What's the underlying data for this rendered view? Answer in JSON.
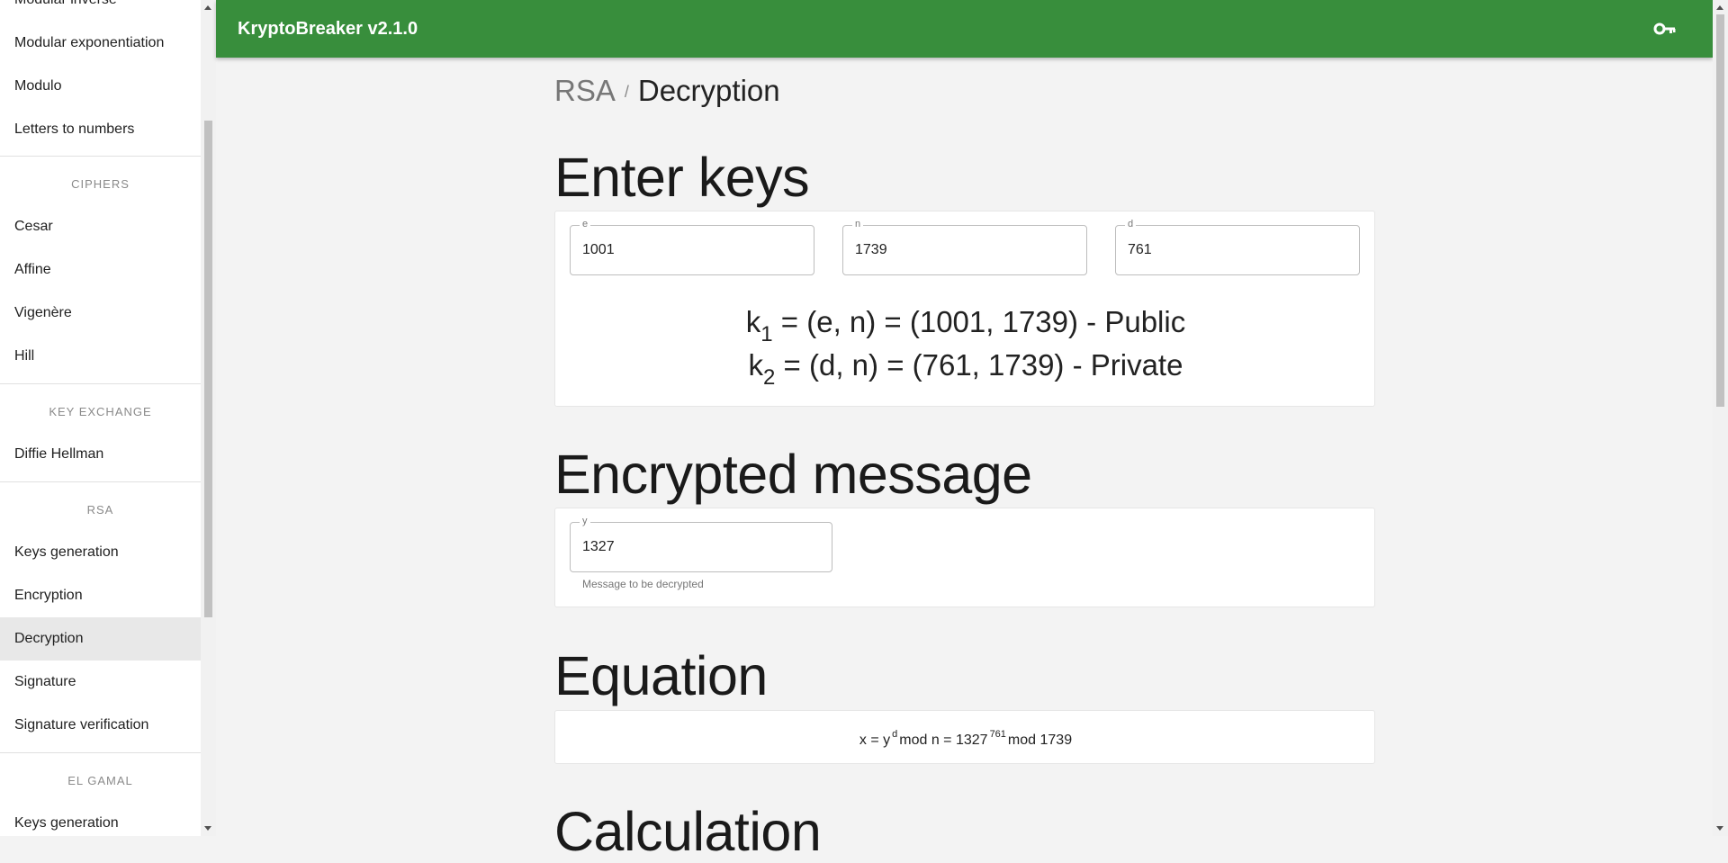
{
  "app": {
    "title": "KryptoBreaker v2.1.0",
    "key_icon": "key-icon"
  },
  "sidebar": {
    "top_items": [
      "Modular inverse",
      "Modular exponentiation",
      "Modulo",
      "Letters to numbers"
    ],
    "sections": [
      {
        "header": "CIPHERS",
        "items": [
          "Cesar",
          "Affine",
          "Vigenère",
          "Hill"
        ]
      },
      {
        "header": "KEY EXCHANGE",
        "items": [
          "Diffie Hellman"
        ]
      },
      {
        "header": "RSA",
        "items": [
          "Keys generation",
          "Encryption",
          "Decryption",
          "Signature",
          "Signature verification"
        ]
      },
      {
        "header": "EL GAMAL",
        "items": [
          "Keys generation"
        ]
      }
    ],
    "active_item": "Decryption"
  },
  "breadcrumb": {
    "root": "RSA",
    "separator": "/",
    "current": "Decryption"
  },
  "enter_keys": {
    "title": "Enter keys",
    "e": {
      "label": "e",
      "value": "1001"
    },
    "n": {
      "label": "n",
      "value": "1739"
    },
    "d": {
      "label": "d",
      "value": "761"
    },
    "k1": {
      "base": "k",
      "sub": "1",
      "text": " = (e, n) = (1001, 1739) - Public"
    },
    "k2": {
      "base": "k",
      "sub": "2",
      "text": " = (d, n) = (761, 1739) - Private"
    }
  },
  "encrypted_message": {
    "title": "Encrypted message",
    "y": {
      "label": "y",
      "value": "1327"
    },
    "hint": "Message to be decrypted"
  },
  "equation": {
    "title": "Equation",
    "part1": "x = y",
    "sup1": "d",
    "part2": "mod n = 1327",
    "sup2": "761",
    "part3": "mod 1739"
  },
  "calculation": {
    "title": "Calculation"
  },
  "colors": {
    "appbar": "#388e3c",
    "active_item_bg": "#e8e8e8"
  }
}
